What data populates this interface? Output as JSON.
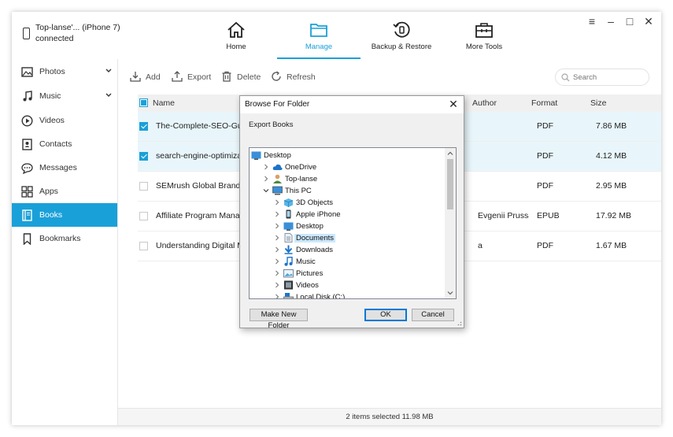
{
  "device": {
    "name": "Top-lanse'... (iPhone 7)",
    "status": "connected"
  },
  "nav": [
    {
      "label": "Home",
      "icon": "home-icon"
    },
    {
      "label": "Manage",
      "icon": "folder-icon",
      "active": true
    },
    {
      "label": "Backup & Restore",
      "icon": "backup-restore-icon"
    },
    {
      "label": "More Tools",
      "icon": "toolbox-icon"
    }
  ],
  "window_controls": {
    "menu": "≡",
    "minimize": "–",
    "maximize": "□",
    "close": "✕"
  },
  "sidebar": {
    "items": [
      {
        "label": "Photos",
        "icon": "photo-icon",
        "expandable": true
      },
      {
        "label": "Music",
        "icon": "music-note-icon",
        "expandable": true
      },
      {
        "label": "Videos",
        "icon": "play-circle-icon"
      },
      {
        "label": "Contacts",
        "icon": "contacts-icon"
      },
      {
        "label": "Messages",
        "icon": "message-bubble-icon"
      },
      {
        "label": "Apps",
        "icon": "apps-grid-icon"
      },
      {
        "label": "Books",
        "icon": "book-icon",
        "active": true
      },
      {
        "label": "Bookmarks",
        "icon": "bookmark-icon"
      }
    ]
  },
  "toolbar": {
    "add": "Add",
    "export": "Export",
    "delete": "Delete",
    "refresh": "Refresh",
    "search_placeholder": "Search"
  },
  "table": {
    "columns": {
      "name": "Name",
      "author": "Author",
      "format": "Format",
      "size": "Size"
    },
    "rows": [
      {
        "name": "The-Complete-SEO-Guide",
        "author": "",
        "format": "PDF",
        "size": "7.86 MB",
        "checked": true
      },
      {
        "name": "search-engine-optimization",
        "author": "",
        "format": "PDF",
        "size": "4.12 MB",
        "checked": true
      },
      {
        "name": "SEMrush Global Brand Book",
        "author": "",
        "format": "PDF",
        "size": "2.95 MB",
        "checked": false
      },
      {
        "name": "Affiliate Program Management",
        "author": "Evgenii Prussakov",
        "format": "EPUB",
        "size": "17.92 MB",
        "checked": false
      },
      {
        "name": "Understanding Digital Marketing",
        "author": "a",
        "format": "PDF",
        "size": "1.67 MB",
        "checked": false
      }
    ]
  },
  "status": {
    "text": "2 items selected 11.98 MB"
  },
  "dialog": {
    "title": "Browse For Folder",
    "description": "Export Books",
    "tree": [
      {
        "label": "Desktop",
        "level": 0,
        "arrow": "none",
        "icon": "desktop-folder-icon"
      },
      {
        "label": "OneDrive",
        "level": 1,
        "arrow": "right",
        "icon": "cloud-icon"
      },
      {
        "label": "Top-lanse",
        "level": 1,
        "arrow": "right",
        "icon": "user-icon"
      },
      {
        "label": "This PC",
        "level": 1,
        "arrow": "down",
        "icon": "computer-icon"
      },
      {
        "label": "3D Objects",
        "level": 2,
        "arrow": "right",
        "icon": "cube-folder-icon"
      },
      {
        "label": "Apple iPhone",
        "level": 2,
        "arrow": "right",
        "icon": "phone-icon"
      },
      {
        "label": "Desktop",
        "level": 2,
        "arrow": "right",
        "icon": "desktop-folder-icon"
      },
      {
        "label": "Documents",
        "level": 2,
        "arrow": "right",
        "icon": "documents-icon",
        "selected": true
      },
      {
        "label": "Downloads",
        "level": 2,
        "arrow": "right",
        "icon": "download-arrow-icon"
      },
      {
        "label": "Music",
        "level": 2,
        "arrow": "right",
        "icon": "music-note-icon"
      },
      {
        "label": "Pictures",
        "level": 2,
        "arrow": "right",
        "icon": "pictures-icon"
      },
      {
        "label": "Videos",
        "level": 2,
        "arrow": "right",
        "icon": "film-icon"
      },
      {
        "label": "Local Disk (C:)",
        "level": 2,
        "arrow": "right",
        "icon": "disk-drive-icon"
      }
    ],
    "buttons": {
      "new_folder": "Make New Folder",
      "ok": "OK",
      "cancel": "Cancel"
    }
  },
  "colors": {
    "accent": "#1aa0d8",
    "selected_row": "#e8f6fb",
    "tree_selection": "#cce8ff"
  }
}
